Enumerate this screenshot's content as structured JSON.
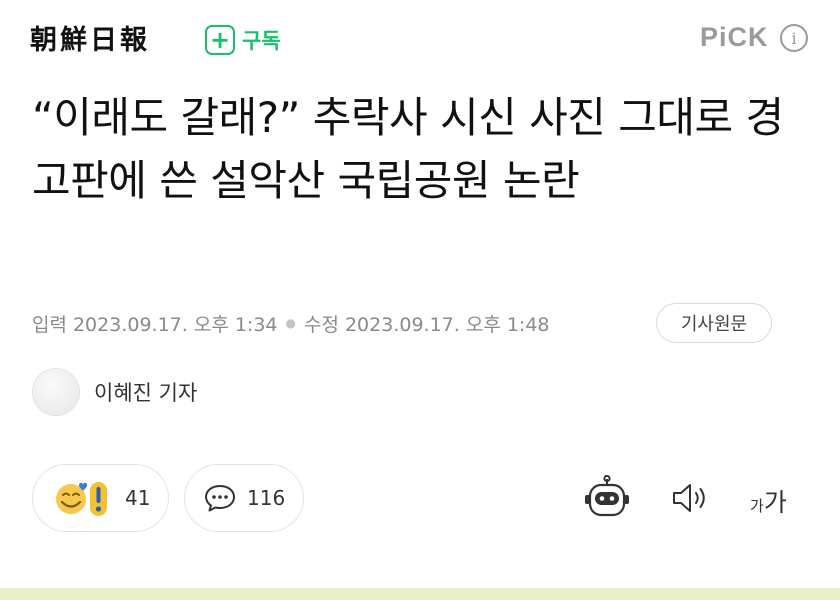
{
  "header": {
    "press_name": "朝鮮日報",
    "subscribe_label": "구독",
    "pick_label": "PiCK",
    "info_label": "i"
  },
  "article": {
    "headline": "“이래도 갈래?” 추락사 시신 사진 그대로 경고판에 쓴 설악산 국립공원 논란",
    "published_label": "입력",
    "published_at": "2023.09.17. 오후 1:34",
    "modified_label": "수정",
    "modified_at": "2023.09.17. 오후 1:48",
    "original_button": "기사원문",
    "reporter": "이혜진 기자"
  },
  "reactions": {
    "emoji_count": "41",
    "comment_count": "116"
  },
  "tools": {
    "font_small": "가",
    "font_large": "가"
  },
  "colors": {
    "accent_green": "#19c06a",
    "muted_gray": "#8a8a8a"
  },
  "icons": [
    "plus-icon",
    "info-icon",
    "emoji-reaction-icon",
    "comment-icon",
    "ai-robot-icon",
    "speaker-icon",
    "font-size-icon"
  ]
}
